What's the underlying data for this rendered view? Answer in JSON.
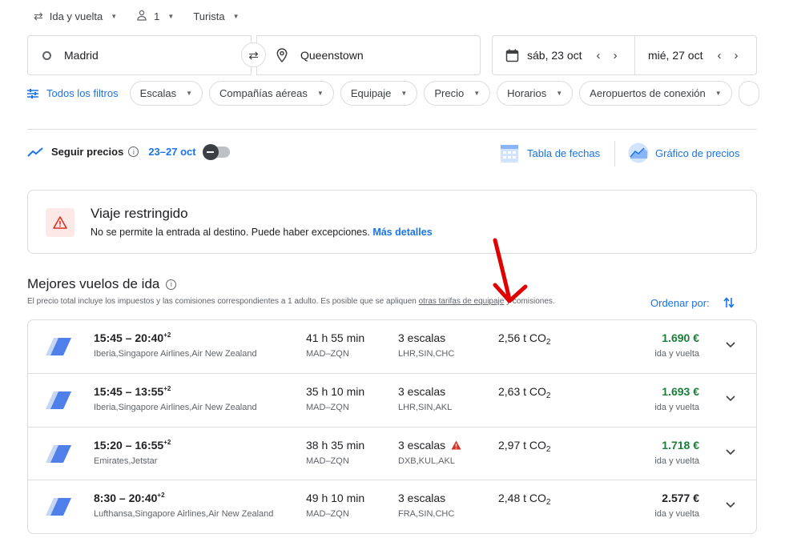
{
  "top": {
    "trip_type": "Ida y vuelta",
    "passengers": "1",
    "cabin": "Turista"
  },
  "search": {
    "origin": "Madrid",
    "destination": "Queenstown",
    "depart_date": "sáb, 23 oct",
    "return_date": "mié, 27 oct"
  },
  "filters": {
    "all_filters": "Todos los filtros",
    "chips": [
      "Escalas",
      "Compañías aéreas",
      "Equipaje",
      "Precio",
      "Horarios",
      "Aeropuertos de conexión"
    ]
  },
  "tracking": {
    "label": "Seguir precios",
    "range": "23–27 oct",
    "date_grid": "Tabla de fechas",
    "price_graph": "Gráfico de precios"
  },
  "restricted": {
    "title": "Viaje restringido",
    "text": "No se permite la entrada al destino. Puede haber excepciones.",
    "link": "Más detalles"
  },
  "section": {
    "title": "Mejores vuelos de ida",
    "note_before": "El precio total incluye los impuestos y las comisiones correspondientes a 1 adulto. Es posible que se apliquen ",
    "note_link": "otras tarifas de equipaje",
    "note_after": " y comisiones.",
    "sort_label": "Ordenar por:"
  },
  "flights": [
    {
      "times": "15:45 – 20:40",
      "plus": "+2",
      "airlines": "Iberia,Singapore Airlines,Air New Zealand",
      "duration": "41 h 55 min",
      "route": "MAD–ZQN",
      "stops": "3 escalas",
      "codes": "LHR,SIN,CHC",
      "co2": "2,56 t CO",
      "co2_sub": "2",
      "price": "1.690 €",
      "price_type": "ida y vuelta"
    },
    {
      "times": "15:45 – 13:55",
      "plus": "+2",
      "airlines": "Iberia,Singapore Airlines,Air New Zealand",
      "duration": "35 h 10 min",
      "route": "MAD–ZQN",
      "stops": "3 escalas",
      "codes": "LHR,SIN,AKL",
      "co2": "2,63 t CO",
      "co2_sub": "2",
      "price": "1.693 €",
      "price_type": "ida y vuelta"
    },
    {
      "times": "15:20 – 16:55",
      "plus": "+2",
      "airlines": "Emirates,Jetstar",
      "duration": "38 h 35 min",
      "route": "MAD–ZQN",
      "stops": "3 escalas",
      "codes": "DXB,KUL,AKL",
      "co2": "2,97 t CO",
      "co2_sub": "2",
      "price": "1.718 €",
      "price_type": "ida y vuelta"
    },
    {
      "times": "8:30 – 20:40",
      "plus": "+2",
      "airlines": "Lufthansa,Singapore Airlines,Air New Zealand",
      "duration": "49 h 10 min",
      "route": "MAD–ZQN",
      "stops": "3 escalas",
      "codes": "FRA,SIN,CHC",
      "co2": "2,48 t CO",
      "co2_sub": "2",
      "price": "2.577 €",
      "price_type": "ida y vuelta"
    }
  ],
  "colors": {
    "accent": "#1a73e8",
    "price_green": "#188038",
    "warning_red": "#d93025",
    "annotation_arrow": "#e00000"
  }
}
